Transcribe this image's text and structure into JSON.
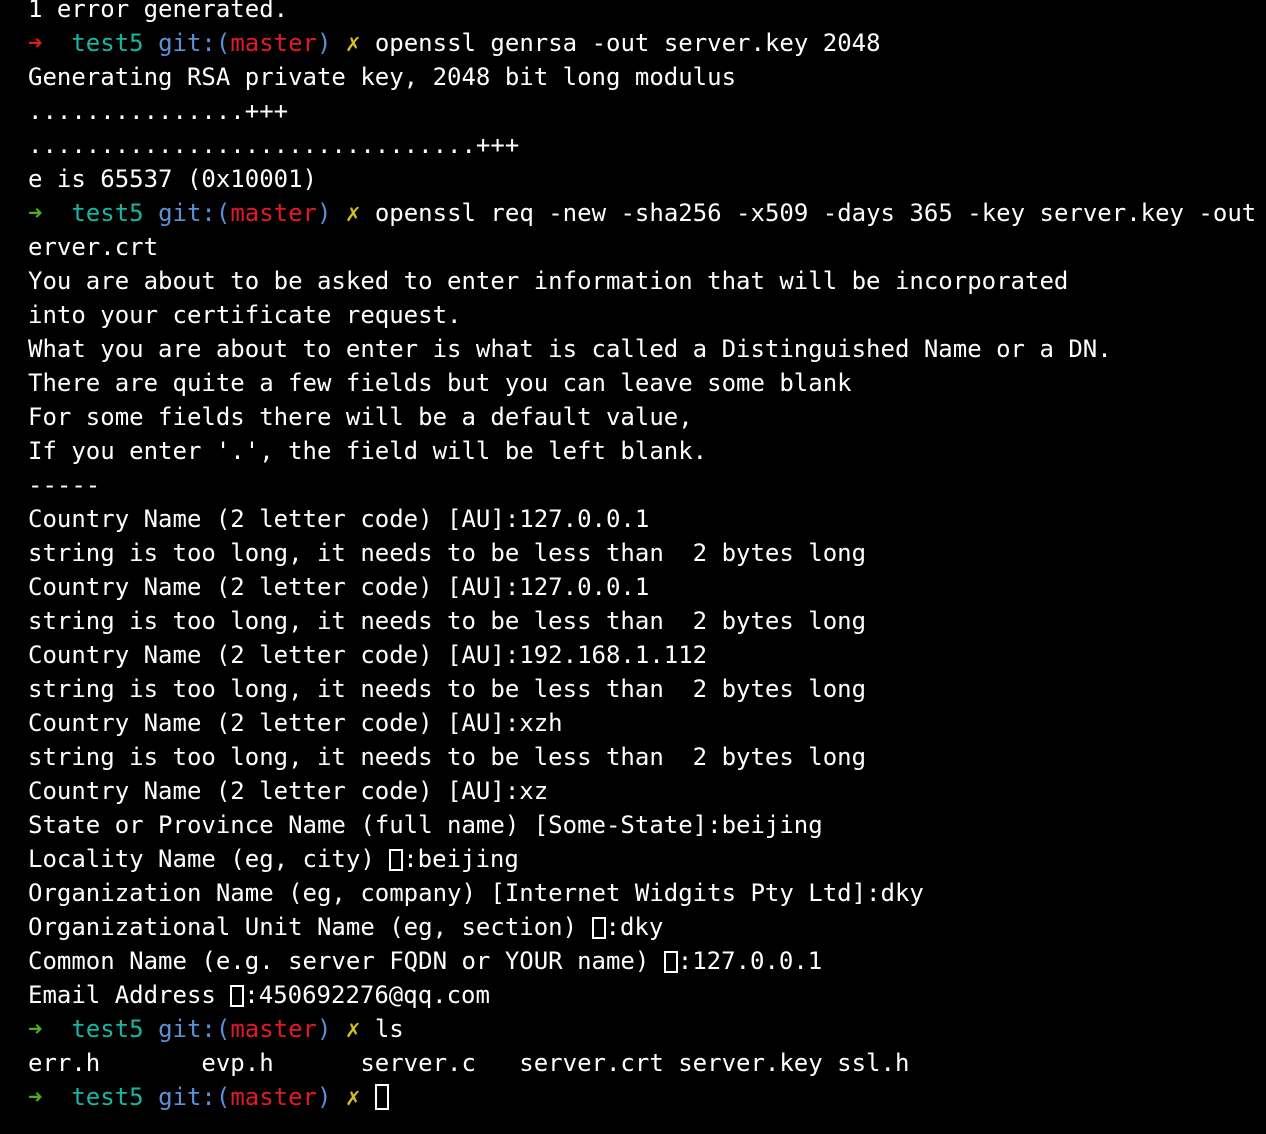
{
  "terminal": {
    "theme": {
      "background": "#000000",
      "foreground": "#ffffff",
      "prompt_arrow_ok": "#4caf1e",
      "prompt_arrow_error": "#e01b24",
      "prompt_host": "#16b6a2",
      "prompt_git": "#5b8fd6",
      "prompt_branch": "#e01b24",
      "prompt_status_mark": "#d8c11a"
    },
    "prompt": {
      "arrow": "➜",
      "host": "test5",
      "git_label": "git:",
      "paren_open": "(",
      "branch": "master",
      "paren_close": ")",
      "dirty_mark": "✗"
    },
    "lines": [
      {
        "id": "l01",
        "type": "output",
        "text": "1 error generated."
      },
      {
        "id": "l02",
        "type": "prompt",
        "arrow_state": "error",
        "command": "openssl genrsa -out server.key 2048"
      },
      {
        "id": "l03",
        "type": "output",
        "text": "Generating RSA private key, 2048 bit long modulus"
      },
      {
        "id": "l04",
        "type": "output",
        "text": "...............+++"
      },
      {
        "id": "l05",
        "type": "output",
        "text": "...............................+++"
      },
      {
        "id": "l06",
        "type": "output",
        "text": "e is 65537 (0x10001)"
      },
      {
        "id": "l07",
        "type": "prompt",
        "arrow_state": "ok",
        "command": "openssl req -new -sha256 -x509 -days 365 -key server.key -out s"
      },
      {
        "id": "l08",
        "type": "output",
        "text": "erver.crt"
      },
      {
        "id": "l09",
        "type": "output",
        "text": "You are about to be asked to enter information that will be incorporated"
      },
      {
        "id": "l10",
        "type": "output",
        "text": "into your certificate request."
      },
      {
        "id": "l11",
        "type": "output",
        "text": "What you are about to enter is what is called a Distinguished Name or a DN."
      },
      {
        "id": "l12",
        "type": "output",
        "text": "There are quite a few fields but you can leave some blank"
      },
      {
        "id": "l13",
        "type": "output",
        "text": "For some fields there will be a default value,"
      },
      {
        "id": "l14",
        "type": "output",
        "text": "If you enter '.', the field will be left blank."
      },
      {
        "id": "l15",
        "type": "output",
        "text": "-----"
      },
      {
        "id": "l16",
        "type": "output",
        "text": "Country Name (2 letter code) [AU]:127.0.0.1"
      },
      {
        "id": "l17",
        "type": "output",
        "text": "string is too long, it needs to be less than  2 bytes long"
      },
      {
        "id": "l18",
        "type": "output",
        "text": "Country Name (2 letter code) [AU]:127.0.0.1"
      },
      {
        "id": "l19",
        "type": "output",
        "text": "string is too long, it needs to be less than  2 bytes long"
      },
      {
        "id": "l20",
        "type": "output",
        "text": "Country Name (2 letter code) [AU]:192.168.1.112"
      },
      {
        "id": "l21",
        "type": "output",
        "text": "string is too long, it needs to be less than  2 bytes long"
      },
      {
        "id": "l22",
        "type": "output",
        "text": "Country Name (2 letter code) [AU]:xzh"
      },
      {
        "id": "l23",
        "type": "output",
        "text": "string is too long, it needs to be less than  2 bytes long"
      },
      {
        "id": "l24",
        "type": "output",
        "text": "Country Name (2 letter code) [AU]:xz"
      },
      {
        "id": "l25",
        "type": "output",
        "text": "State or Province Name (full name) [Some-State]:beijing"
      },
      {
        "id": "l26",
        "type": "output_box",
        "before": "Locality Name (eg, city) ",
        "after": ":beijing"
      },
      {
        "id": "l27",
        "type": "output",
        "text": "Organization Name (eg, company) [Internet Widgits Pty Ltd]:dky"
      },
      {
        "id": "l28",
        "type": "output_box",
        "before": "Organizational Unit Name (eg, section) ",
        "after": ":dky"
      },
      {
        "id": "l29",
        "type": "output_box",
        "before": "Common Name (e.g. server FQDN or YOUR name) ",
        "after": ":127.0.0.1"
      },
      {
        "id": "l30",
        "type": "output_box",
        "before": "Email Address ",
        "after": ":450692276@qq.com"
      },
      {
        "id": "l31",
        "type": "prompt",
        "arrow_state": "ok",
        "command": "ls"
      },
      {
        "id": "l32",
        "type": "output",
        "text": "err.h       evp.h      server.c   server.crt server.key ssl.h"
      },
      {
        "id": "l33",
        "type": "prompt_cursor",
        "arrow_state": "ok",
        "command": ""
      }
    ]
  }
}
